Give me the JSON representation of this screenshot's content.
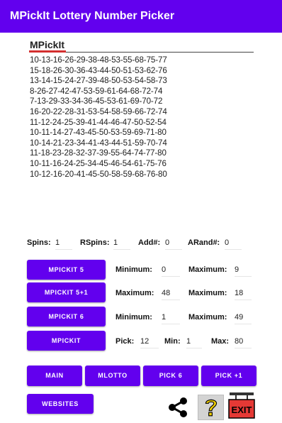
{
  "app": {
    "title": "MPickIt Lottery Number Picker"
  },
  "results": {
    "heading": "MPickIt",
    "lines": [
      "10-13-16-26-29-38-48-53-55-68-75-77",
      "15-18-26-30-36-43-44-50-51-53-62-76",
      "13-14-15-24-27-39-48-50-53-54-58-73",
      "8-26-27-42-47-53-59-61-64-68-72-74",
      "7-13-29-33-34-36-45-53-61-69-70-72",
      "16-20-22-28-31-53-54-58-59-66-72-74",
      "11-12-24-25-39-41-44-46-47-50-52-54",
      "10-11-14-27-43-45-50-53-59-69-71-80",
      "10-14-21-23-34-41-43-44-51-59-70-74",
      "11-18-23-28-32-37-39-55-64-74-77-80",
      "10-11-16-24-25-34-45-46-54-61-75-76",
      "10-12-16-20-41-45-50-58-59-68-76-80"
    ]
  },
  "stats": {
    "spins_label": "Spins:",
    "spins_value": "1",
    "rspins_label": "RSpins:",
    "rspins_value": "1",
    "add_label": "Add#:",
    "add_value": "0",
    "arand_label": "ARand#:",
    "arand_value": "0"
  },
  "rows": {
    "r1": {
      "button": "MPICKIT 5",
      "l1": "Minimum:",
      "v1": "0",
      "l2": "Maximum:",
      "v2": "9"
    },
    "r2": {
      "button": "MPICKIT 5+1",
      "l1": "Maximum:",
      "v1": "48",
      "l2": "Maximum:",
      "v2": "18"
    },
    "r3": {
      "button": "MPICKIT 6",
      "l1": "Minimum:",
      "v1": "1",
      "l2": "Maximum:",
      "v2": "49"
    },
    "r4": {
      "button": "MPICKIT",
      "l1": "Pick:",
      "v1": "12",
      "l2": "Min:",
      "v2": "1",
      "l3": "Max:",
      "v3": "80"
    }
  },
  "nav": {
    "main": "MAIN",
    "mlotto": "MLOTTO",
    "pick6": "PICK 6",
    "pick1": "PICK +1",
    "websites": "WEBSITES"
  },
  "icons": {
    "share": "share-icon",
    "help": "help-icon",
    "exit": "exit-icon"
  },
  "exit_label": "EXIT",
  "colors": {
    "primary": "#6200ee",
    "underline_red": "#d32f2f",
    "help_yellow": "#f2d000",
    "exit_red": "#e53935"
  }
}
